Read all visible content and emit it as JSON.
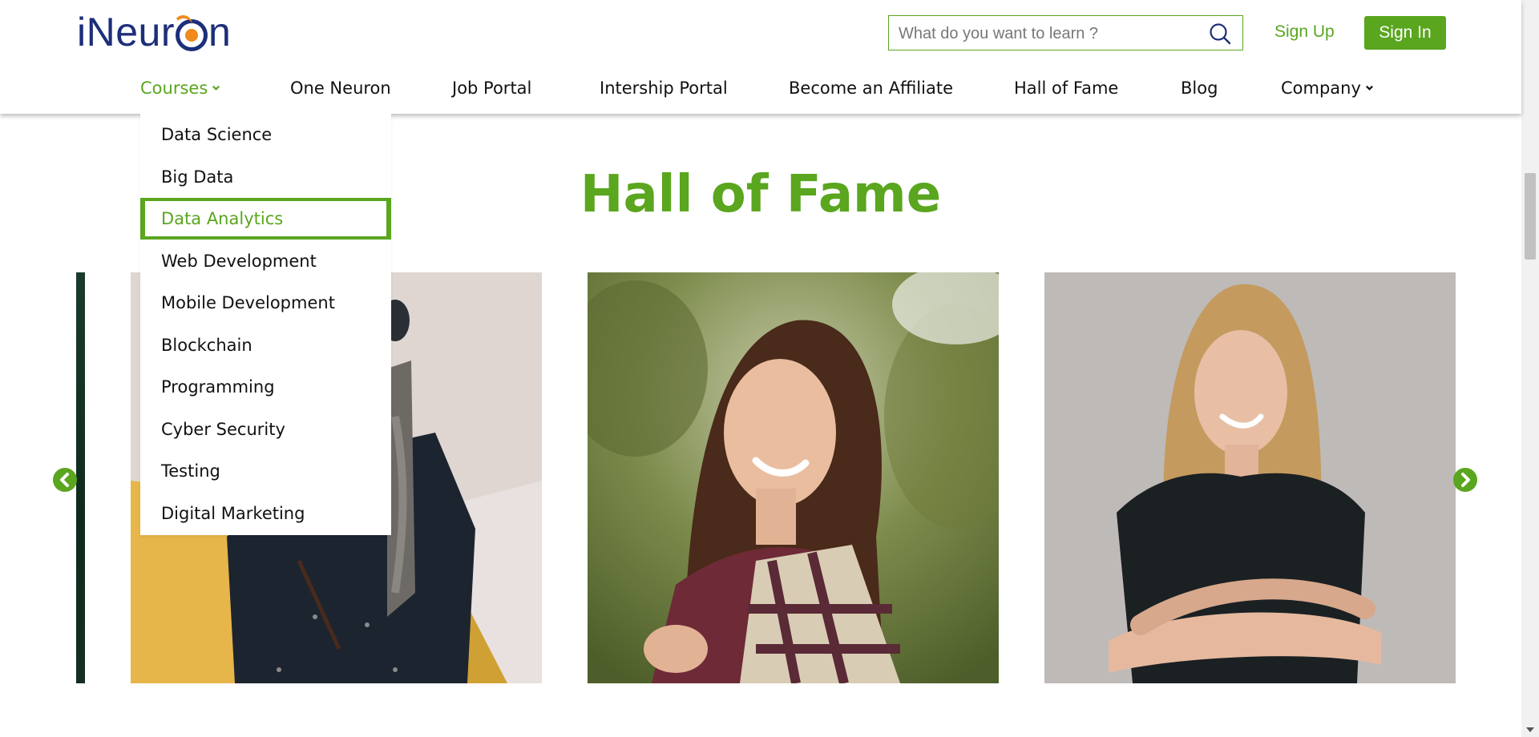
{
  "header": {
    "logo_text_before": "iNeur",
    "logo_text_after": "n",
    "search": {
      "placeholder": "What do you want to learn ?",
      "value": ""
    },
    "signup_label": "Sign Up",
    "signin_label": "Sign In"
  },
  "nav": {
    "items": [
      {
        "label": "Courses",
        "has_dropdown": true,
        "active": true
      },
      {
        "label": "One Neuron"
      },
      {
        "label": "Job Portal"
      },
      {
        "label": "Intership Portal"
      },
      {
        "label": "Become an Affiliate"
      },
      {
        "label": "Hall of Fame"
      },
      {
        "label": "Blog"
      },
      {
        "label": "Company",
        "has_dropdown": true
      }
    ]
  },
  "dropdown": {
    "items": [
      {
        "label": "Data Science"
      },
      {
        "label": "Big Data"
      },
      {
        "label": "Data Analytics",
        "highlighted": true
      },
      {
        "label": "Web Development"
      },
      {
        "label": "Mobile Development"
      },
      {
        "label": "Blockchain"
      },
      {
        "label": "Programming"
      },
      {
        "label": "Cyber Security"
      },
      {
        "label": "Testing"
      },
      {
        "label": "Digital Marketing"
      }
    ]
  },
  "main": {
    "title": "Hall of Fame",
    "carousel": {
      "prev_icon": "chevron-left-icon",
      "next_icon": "chevron-right-icon"
    }
  },
  "colors": {
    "brand_green": "#5aa61f",
    "logo_blue": "#1d2e7a",
    "logo_orange": "#f08a1c"
  }
}
